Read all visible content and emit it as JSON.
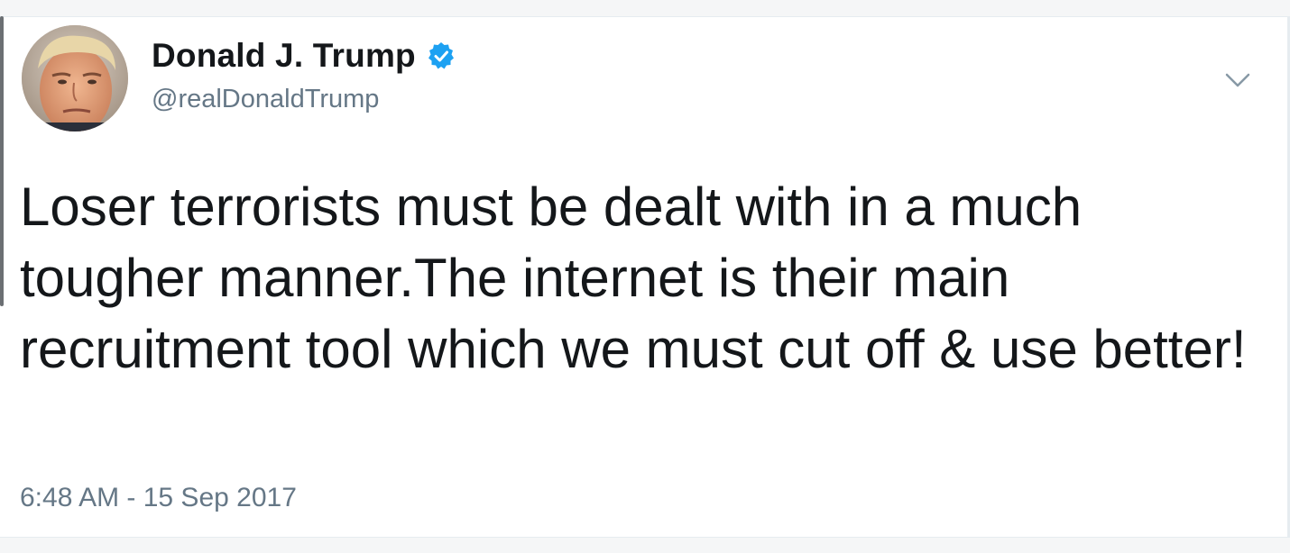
{
  "tweet": {
    "author": {
      "display_name": "Donald J. Trump",
      "handle": "@realDonaldTrump",
      "verified": true,
      "verified_color": "#1da1f2",
      "avatar_icon": "profile-photo"
    },
    "text": "Loser terrorists must be dealt with in a much tougher manner.The internet is their main recruitment tool which we must cut off & use better!",
    "timestamp": "6:48 AM - 15 Sep 2017",
    "menu_icon": "chevron-down-icon"
  },
  "colors": {
    "text_primary": "#14171a",
    "text_secondary": "#657786",
    "background": "#ffffff"
  }
}
